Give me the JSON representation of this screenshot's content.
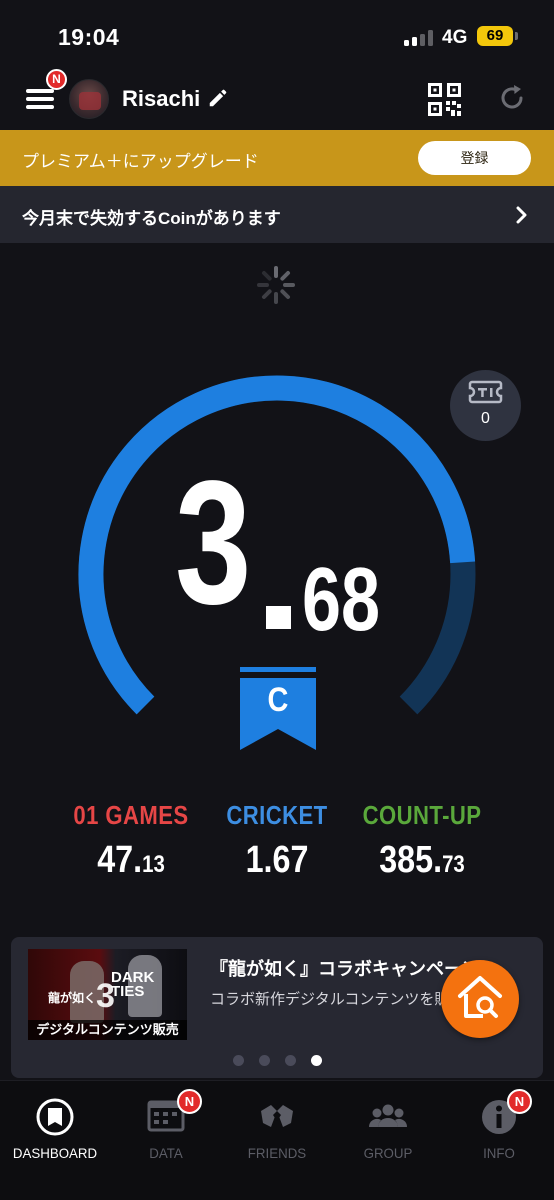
{
  "status_bar": {
    "time": "19:04",
    "network": "4G",
    "battery": "69"
  },
  "header": {
    "menu_badge": "N",
    "username": "Risachi"
  },
  "premium": {
    "text": "プレミアム＋にアップグレード",
    "button": "登録"
  },
  "coin_notice": {
    "text": "今月末で失効するCoinがあります"
  },
  "ticket": {
    "count": "0"
  },
  "rating": {
    "integer": "3",
    "decimal": "68",
    "value": 3.68,
    "gauge_fill": 0.82,
    "class": "C",
    "colors": {
      "gauge_fill": "#1e7fe0",
      "gauge_track": "#123456"
    }
  },
  "stats": [
    {
      "label": "01 GAMES",
      "int": "47.",
      "dec": "13",
      "color": "#e64646"
    },
    {
      "label": "CRICKET",
      "int": "1.67",
      "dec": "",
      "color": "#3d8ee2"
    },
    {
      "label": "COUNT-UP",
      "int": "385.",
      "dec": "73",
      "color": "#5aa83b"
    }
  ],
  "campaign": {
    "title": "『龍が如く』コラボキャンペーン",
    "subtitle": "コラボ新作デジタルコンテンツを販売",
    "thumb_left": "龍が如く",
    "thumb_number": "3",
    "thumb_right_top": "DARK",
    "thumb_right_bottom": "TIES",
    "thumb_bottom": "デジタルコンテンツ販売",
    "dots_total": 4,
    "dots_active": 4
  },
  "nav": {
    "items": [
      {
        "label": "DASHBOARD",
        "icon": "dashboard-icon",
        "active": true
      },
      {
        "label": "DATA",
        "icon": "data-icon",
        "badge": "N"
      },
      {
        "label": "FRIENDS",
        "icon": "friends-icon"
      },
      {
        "label": "GROUP",
        "icon": "group-icon"
      },
      {
        "label": "INFO",
        "icon": "info-icon",
        "badge": "N"
      }
    ]
  }
}
